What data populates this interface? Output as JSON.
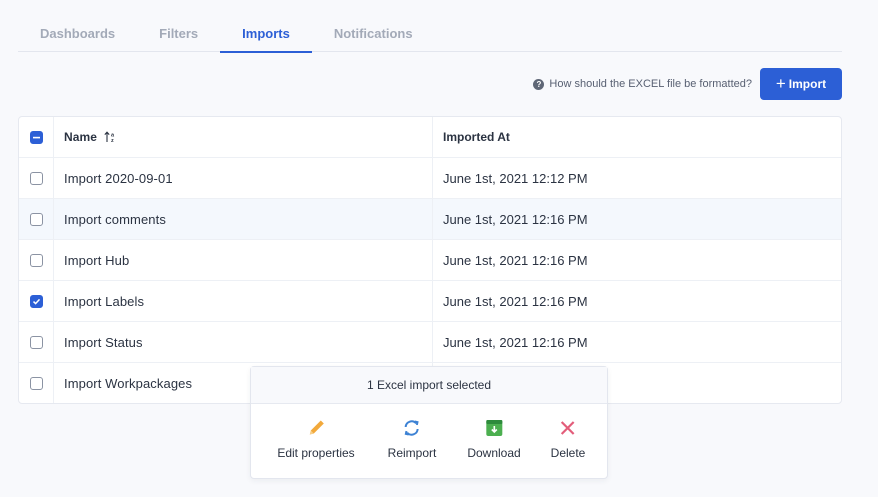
{
  "tabs": [
    {
      "label": "Dashboards",
      "active": false
    },
    {
      "label": "Filters",
      "active": false
    },
    {
      "label": "Imports",
      "active": true
    },
    {
      "label": "Notifications",
      "active": false
    }
  ],
  "toolbar": {
    "help_text": "How should the EXCEL file be formatted?",
    "help_icon": "question-circle-icon",
    "import_label": "Import",
    "import_icon": "plus-icon"
  },
  "table": {
    "columns": [
      "Name",
      "Imported At"
    ],
    "rows": [
      {
        "name": "Import 2020-09-01",
        "imported_at": "June 1st, 2021 12:12 PM",
        "checked": false
      },
      {
        "name": "Import comments",
        "imported_at": "June 1st, 2021 12:16 PM",
        "checked": false
      },
      {
        "name": "Import Hub",
        "imported_at": "June 1st, 2021 12:16 PM",
        "checked": false
      },
      {
        "name": "Import Labels",
        "imported_at": "June 1st, 2021 12:16 PM",
        "checked": true
      },
      {
        "name": "Import Status",
        "imported_at": "June 1st, 2021 12:16 PM",
        "checked": false
      },
      {
        "name": "Import Workpackages",
        "imported_at": "",
        "checked": false
      }
    ]
  },
  "bulk": {
    "title": "1 Excel import selected",
    "actions": [
      {
        "label": "Edit properties",
        "icon": "pencil-icon"
      },
      {
        "label": "Reimport",
        "icon": "refresh-icon"
      },
      {
        "label": "Download",
        "icon": "download-icon"
      },
      {
        "label": "Delete",
        "icon": "close-icon"
      }
    ]
  },
  "colors": {
    "accent": "#2c5fd6",
    "pencil": "#f2a93b",
    "reimport": "#3d82d4",
    "download": "#4caf50",
    "delete": "#e35d7a"
  }
}
